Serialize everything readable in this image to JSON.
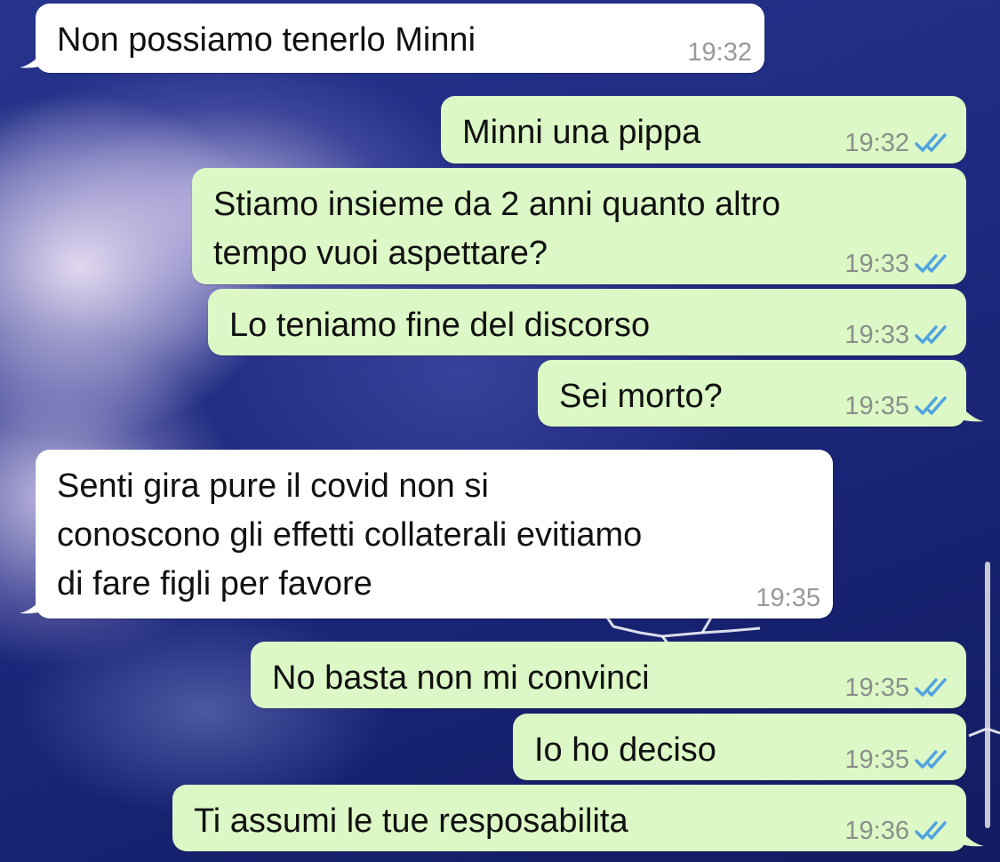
{
  "messages": [
    {
      "id": "m1",
      "direction": "in",
      "text": "Non possiamo tenerlo Minni",
      "time": "19:32",
      "tail": true
    },
    {
      "id": "m2",
      "direction": "out",
      "text": "Minni una pippa",
      "time": "19:32",
      "status": "read",
      "tail": false
    },
    {
      "id": "m3",
      "direction": "out",
      "text": "Stiamo insieme da 2 anni quanto altro\ntempo vuoi aspettare?",
      "time": "19:33",
      "status": "read",
      "tail": false
    },
    {
      "id": "m4",
      "direction": "out",
      "text": "Lo teniamo fine del discorso",
      "time": "19:33",
      "status": "read",
      "tail": false
    },
    {
      "id": "m5",
      "direction": "out",
      "text": "Sei morto?",
      "time": "19:35",
      "status": "read",
      "tail": true
    },
    {
      "id": "m6",
      "direction": "in",
      "text": "Senti gira pure il covid non si\nconoscono gli effetti collaterali evitiamo\ndi fare figli per favore",
      "time": "19:35",
      "tail": true
    },
    {
      "id": "m7",
      "direction": "out",
      "text": "No basta non mi convinci",
      "time": "19:35",
      "status": "read",
      "tail": false
    },
    {
      "id": "m8",
      "direction": "out",
      "text": "Io ho deciso",
      "time": "19:35",
      "status": "read",
      "tail": false
    },
    {
      "id": "m9",
      "direction": "out",
      "text": "Ti assumi le tue resposabilita",
      "time": "19:36",
      "status": "read",
      "tail": true
    }
  ],
  "colors": {
    "incoming_bubble": "#ffffff",
    "outgoing_bubble": "#dcf8c6",
    "read_ticks": "#4fa3e0",
    "timestamp": "#8a8f8a"
  },
  "icons": {
    "read_receipt": "double-check-icon"
  }
}
